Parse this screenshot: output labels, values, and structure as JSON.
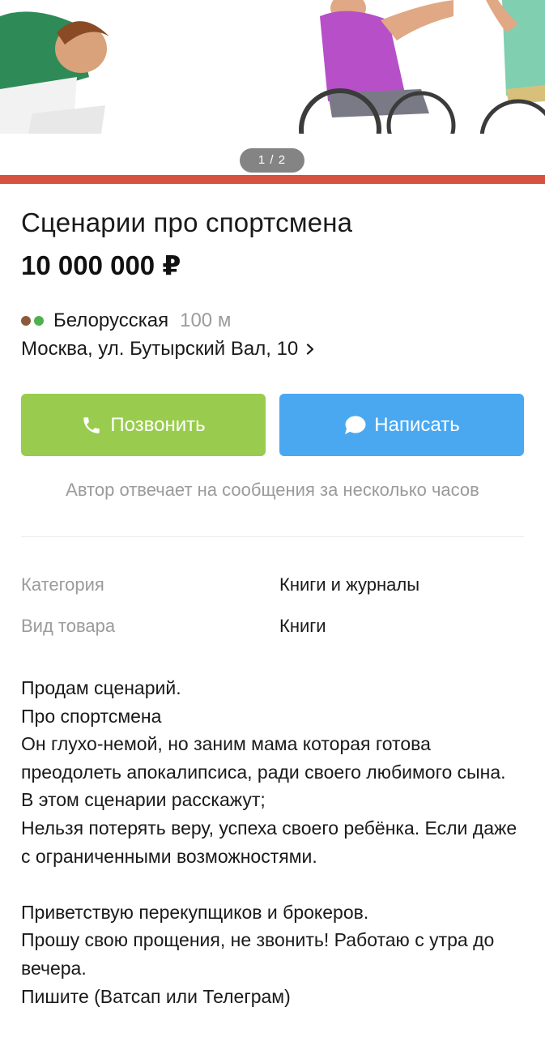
{
  "gallery": {
    "counter": "1 / 2",
    "colors": {
      "bar": "#d6523f"
    }
  },
  "listing": {
    "title": "Сценарии про спортсмена",
    "price": "10 000 000 ₽"
  },
  "location": {
    "metro_station": "Белорусская",
    "metro_distance": "100 м",
    "metro_colors": [
      "#8b5a3c",
      "#4fb04f"
    ],
    "address": "Москва, ул. Бутырский Вал, 10"
  },
  "actions": {
    "call_label": "Позвонить",
    "message_label": "Написать",
    "call_color": "#99cc4e",
    "message_color": "#4aa8f1",
    "call_icon": "phone-icon",
    "message_icon": "chat-bubble-icon"
  },
  "reply_hint": "Автор отвечает на сообщения за несколько часов",
  "params": [
    {
      "label": "Категория",
      "value": "Книги и журналы"
    },
    {
      "label": "Вид товара",
      "value": "Книги"
    }
  ],
  "description": "Продам сценарий.\nПро спортсмена\nОн  глухо-немой, но заним мама которая готова преодолеть апокалипсиса, ради своего любимого сына.\nВ этом сценарии расскажут;\nНельзя потерять веру, успеха своего ребёнка. Если даже с ограниченными возможностями.\n\n Приветствую перекупщиков и брокеров.\n Прошу свою прощения, не звонить! Работаю с утра до вечера.\n Пишите (Ватсап или Телеграм)"
}
